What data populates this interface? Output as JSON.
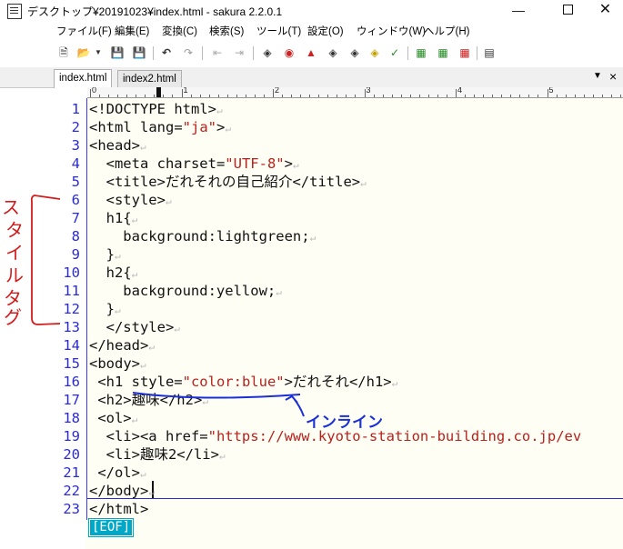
{
  "window": {
    "title": "デスクトップ¥20191023¥index.html - sakura 2.2.0.1"
  },
  "menu": [
    "ファイル(F)",
    "編集(E)",
    "変換(C)",
    "検索(S)",
    "ツール(T)",
    "設定(O)",
    "ウィンドウ(W)",
    "ヘルプ(H)"
  ],
  "toolbar": [
    "new-file-icon",
    "open-folder-icon",
    "dropdown-arrow-icon",
    "save-icon",
    "save-all-icon",
    "undo-icon",
    "redo-icon",
    "back-icon",
    "forward-icon",
    "search-prev-icon",
    "search-mark-icon",
    "search-up-icon",
    "search-down-icon",
    "search-clear-icon",
    "search-highlight-icon",
    "grep-icon",
    "outline-icon",
    "compare-icon",
    "tag-jump-icon",
    "settings-icon"
  ],
  "tabs": [
    {
      "label": "index.html",
      "active": true
    },
    {
      "label": "index2.html",
      "active": false
    }
  ],
  "ruler": [
    "0",
    "1",
    "2",
    "3",
    "4",
    "5"
  ],
  "code": {
    "numbers": [
      "1",
      "2",
      "3",
      "4",
      "5",
      "6",
      "7",
      "8",
      "9",
      "10",
      "11",
      "12",
      "13",
      "14",
      "15",
      "16",
      "17",
      "18",
      "19",
      "20",
      "21",
      "22",
      "23"
    ],
    "lines": [
      [
        "<!DOCTYPE html>"
      ],
      [
        "<html lang=",
        "\"ja\"",
        ">"
      ],
      [
        "<head>"
      ],
      [
        "<meta charset=",
        "\"UTF-8\"",
        ">"
      ],
      [
        "<title>だれそれの自己紹介</title>"
      ],
      [
        "<style>"
      ],
      [
        "h1{"
      ],
      [
        "background:lightgreen;"
      ],
      [
        "}"
      ],
      [
        "h2{"
      ],
      [
        "background:yellow;"
      ],
      [
        "}"
      ],
      [
        "</style>"
      ],
      [
        "</head>"
      ],
      [
        "<body>"
      ],
      [
        "<h1 style=",
        "\"color:blue\"",
        ">だれそれ</h1>"
      ],
      [
        "<h2>趣味</h2>"
      ],
      [
        "<ol>"
      ],
      [
        "<li><a href=",
        "\"https://www.kyoto-station-building.co.jp/ev"
      ],
      [
        "<li>趣味2</li>"
      ],
      [
        "</ol>"
      ],
      [
        "</body>"
      ],
      [
        "</html>"
      ]
    ],
    "eof": "[EOF]"
  },
  "annotations": {
    "left_note": [
      "ス",
      "タ",
      "イ",
      "ル",
      "タ",
      "グ"
    ],
    "inline_note": "インライン",
    "ink_color": "#d41c1c",
    "ink_color_blue": "#1a2fd8"
  },
  "colors": {
    "line_number": "#2b2bd6",
    "string": "#b8211c",
    "editor_bg": "#fffef5",
    "eof_bg": "#00a8c8"
  }
}
